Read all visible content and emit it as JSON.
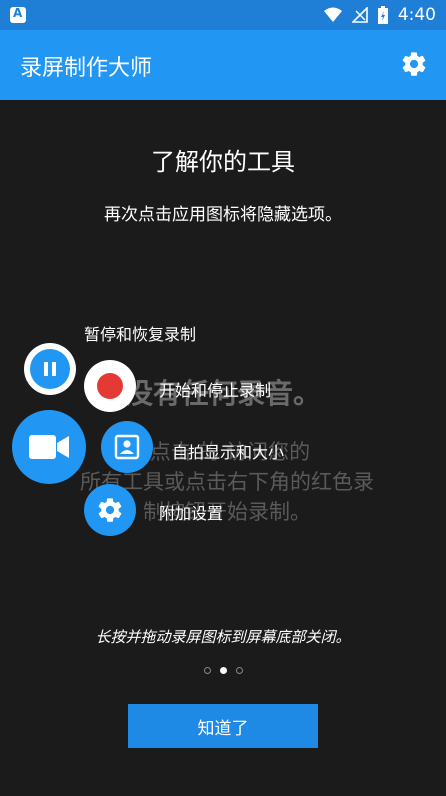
{
  "status_bar": {
    "time": "4:40",
    "left_icon": "app-a-icon"
  },
  "app_bar": {
    "title": "录屏制作大师",
    "settings_icon": "gear-icon"
  },
  "background": {
    "title": "没有任何录音。",
    "line1": "点击 的 访问您的",
    "line2": "所有工具或点击右下角的红色录",
    "line3": "制按钮开始录制。"
  },
  "overlay": {
    "title": "了解你的工具",
    "subtitle": "再次点击应用图标将隐藏选项。",
    "labels": {
      "pause": "暂停和恢复录制",
      "record": "开始和停止录制",
      "selfie": "自拍显示和大小",
      "settings": "附加设置"
    },
    "hint": "长按并拖动录屏图标到屏幕底部关闭。",
    "pager": {
      "count": 3,
      "active_index": 1
    },
    "ok_button": "知道了"
  },
  "colors": {
    "primary": "#2196f3",
    "status": "#1f7fd6",
    "record": "#e53935",
    "background": "#1b1b1b"
  }
}
